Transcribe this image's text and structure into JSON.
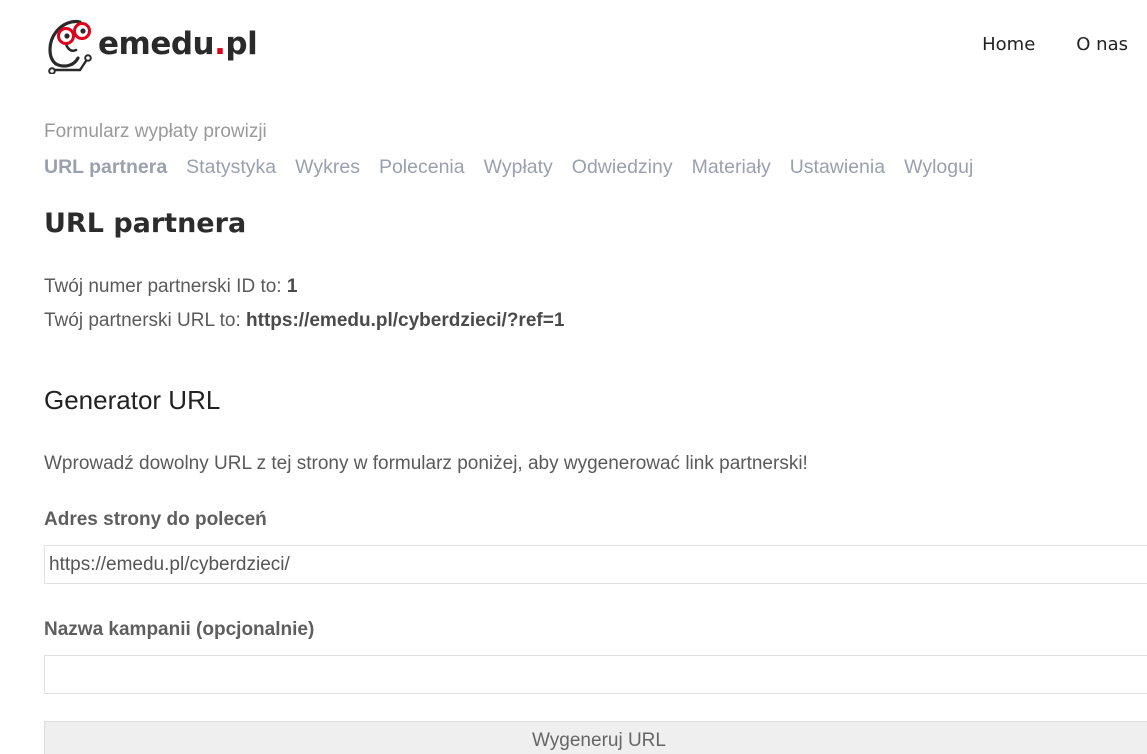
{
  "header": {
    "logo": {
      "name": "emedu",
      "dot": ".",
      "tld": "pl"
    },
    "nav": [
      {
        "label": "Home"
      },
      {
        "label": "O nas"
      }
    ]
  },
  "colors": {
    "accent_red": "#e0001b",
    "tab_text": "#9aa0ad",
    "heading": "#2c2c2c"
  },
  "affiliate": {
    "form_title": "Formularz wypłaty prowizji",
    "tabs": [
      {
        "label": "URL partnera",
        "active": true
      },
      {
        "label": "Statystyka",
        "active": false
      },
      {
        "label": "Wykres",
        "active": false
      },
      {
        "label": "Polecenia",
        "active": false
      },
      {
        "label": "Wypłaty",
        "active": false
      },
      {
        "label": "Odwiedziny",
        "active": false
      },
      {
        "label": "Materiały",
        "active": false
      },
      {
        "label": "Ustawienia",
        "active": false
      },
      {
        "label": "Wyloguj",
        "active": false
      }
    ],
    "section_title": "URL partnera",
    "id_text": "Twój numer partnerski ID to: ",
    "id_value": "1",
    "url_text": "Twój partnerski URL to: ",
    "url_value": "https://emedu.pl/cyberdzieci/?ref=1"
  },
  "generator": {
    "title": "Generator URL",
    "description": "Wprowadź dowolny URL z tej strony w formularz poniżej, aby wygenerować link partnerski!",
    "page_url_label": "Adres strony do poleceń",
    "page_url_value": "https://emedu.pl/cyberdzieci/",
    "campaign_label": "Nazwa kampanii (opcjonalnie)",
    "campaign_value": "",
    "button_label": "Wygeneruj URL"
  },
  "icons": {
    "logo": "owl-scooter-logo-icon"
  }
}
